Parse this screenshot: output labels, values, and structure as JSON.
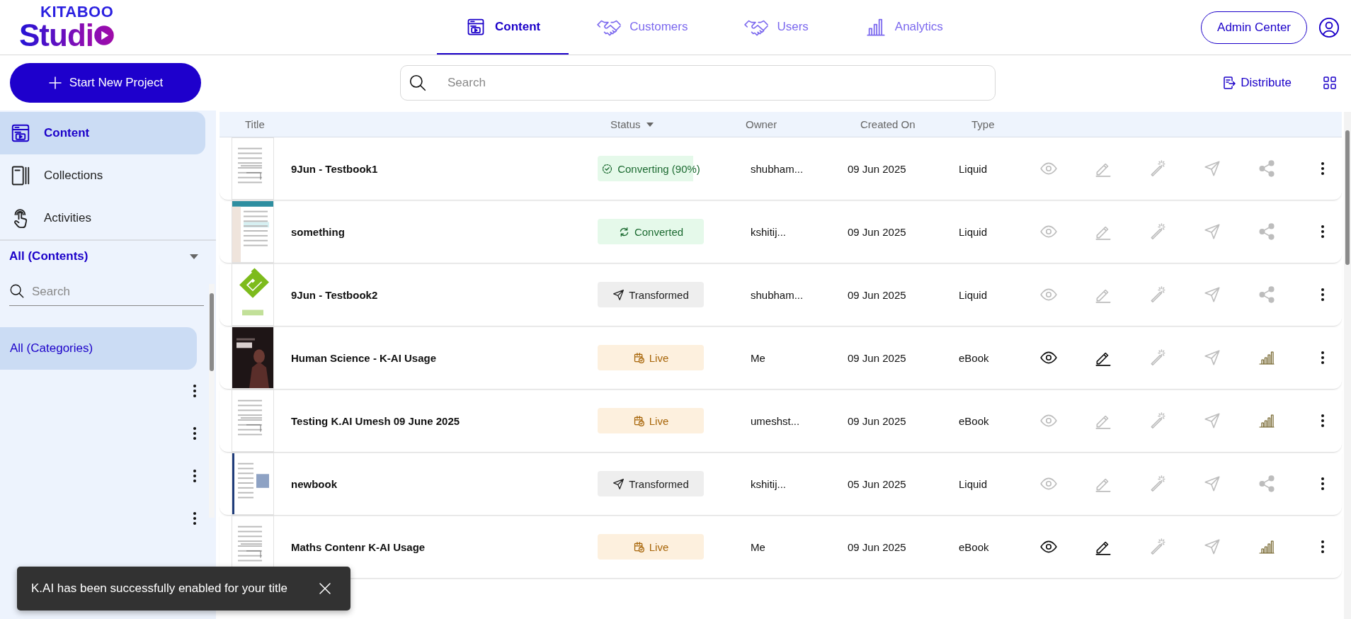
{
  "logo": {
    "brand": "KITABOO",
    "product": "Studi"
  },
  "nav_tabs": [
    {
      "label": "Content",
      "selected": true
    },
    {
      "label": "Customers",
      "selected": false
    },
    {
      "label": "Users",
      "selected": false
    },
    {
      "label": "Analytics",
      "selected": false
    }
  ],
  "admin_button": "Admin Center",
  "new_project_button": "Start New Project",
  "search": {
    "placeholder": "Search"
  },
  "distribute_button": "Distribute",
  "sidebar": {
    "items": [
      {
        "label": "Content",
        "selected": true
      },
      {
        "label": "Collections",
        "selected": false
      },
      {
        "label": "Activities",
        "selected": false
      }
    ],
    "filter": "All (Contents)",
    "search": {
      "placeholder": "Search"
    },
    "categories": [
      {
        "label": "All (Categories)",
        "selected": true
      },
      {
        "selected": false
      },
      {
        "selected": false
      },
      {
        "selected": false
      },
      {
        "selected": false
      }
    ]
  },
  "table": {
    "columns": [
      {
        "label": "Title",
        "sorted": false
      },
      {
        "label": "Status",
        "sorted": true
      },
      {
        "label": "Owner",
        "sorted": false
      },
      {
        "label": "Created On",
        "sorted": false
      },
      {
        "label": "Type",
        "sorted": false
      }
    ],
    "rows": [
      {
        "title": "9Jun - Testbook1",
        "status": {
          "label": "Converting (90%)",
          "kind": "converting",
          "level": 0.9
        },
        "owner": "shubham...",
        "created": "09 Jun 2025",
        "type": "Liquid",
        "view_disabled": true,
        "edit_disabled": true,
        "kind": "share"
      },
      {
        "title": "something",
        "status": {
          "label": "Converted",
          "kind": "converted"
        },
        "owner": "kshitij...",
        "created": "09 Jun 2025",
        "type": "Liquid",
        "view_disabled": true,
        "edit_disabled": true,
        "kind": "share"
      },
      {
        "title": "9Jun - Testbook2",
        "status": {
          "label": "Transformed",
          "kind": "transformed"
        },
        "owner": "shubham...",
        "created": "09 Jun 2025",
        "type": "Liquid",
        "view_disabled": true,
        "edit_disabled": true,
        "kind": "share"
      },
      {
        "title": "Human Science - K-AI Usage",
        "status": {
          "label": "Live",
          "kind": "live"
        },
        "owner": "Me",
        "created": "09 Jun 2025",
        "type": "eBook",
        "view_disabled": false,
        "edit_disabled": false,
        "kind": "analytics"
      },
      {
        "title": "Testing K.AI Umesh 09 June 2025",
        "status": {
          "label": "Live",
          "kind": "live"
        },
        "owner": "umeshst...",
        "created": "09 Jun 2025",
        "type": "eBook",
        "view_disabled": true,
        "edit_disabled": true,
        "kind": "analytics"
      },
      {
        "title": "newbook",
        "status": {
          "label": "Transformed",
          "kind": "transformed"
        },
        "owner": "kshitij...",
        "created": "05 Jun 2025",
        "type": "Liquid",
        "view_disabled": true,
        "edit_disabled": true,
        "kind": "share"
      },
      {
        "title": "Maths Contenr K-AI Usage",
        "status": {
          "label": "Live",
          "kind": "live"
        },
        "owner": "Me",
        "created": "09 Jun 2025",
        "type": "eBook",
        "view_disabled": false,
        "edit_disabled": false,
        "kind": "analytics"
      }
    ]
  },
  "toast": {
    "message": "K.AI has been successfully enabled for your title"
  }
}
